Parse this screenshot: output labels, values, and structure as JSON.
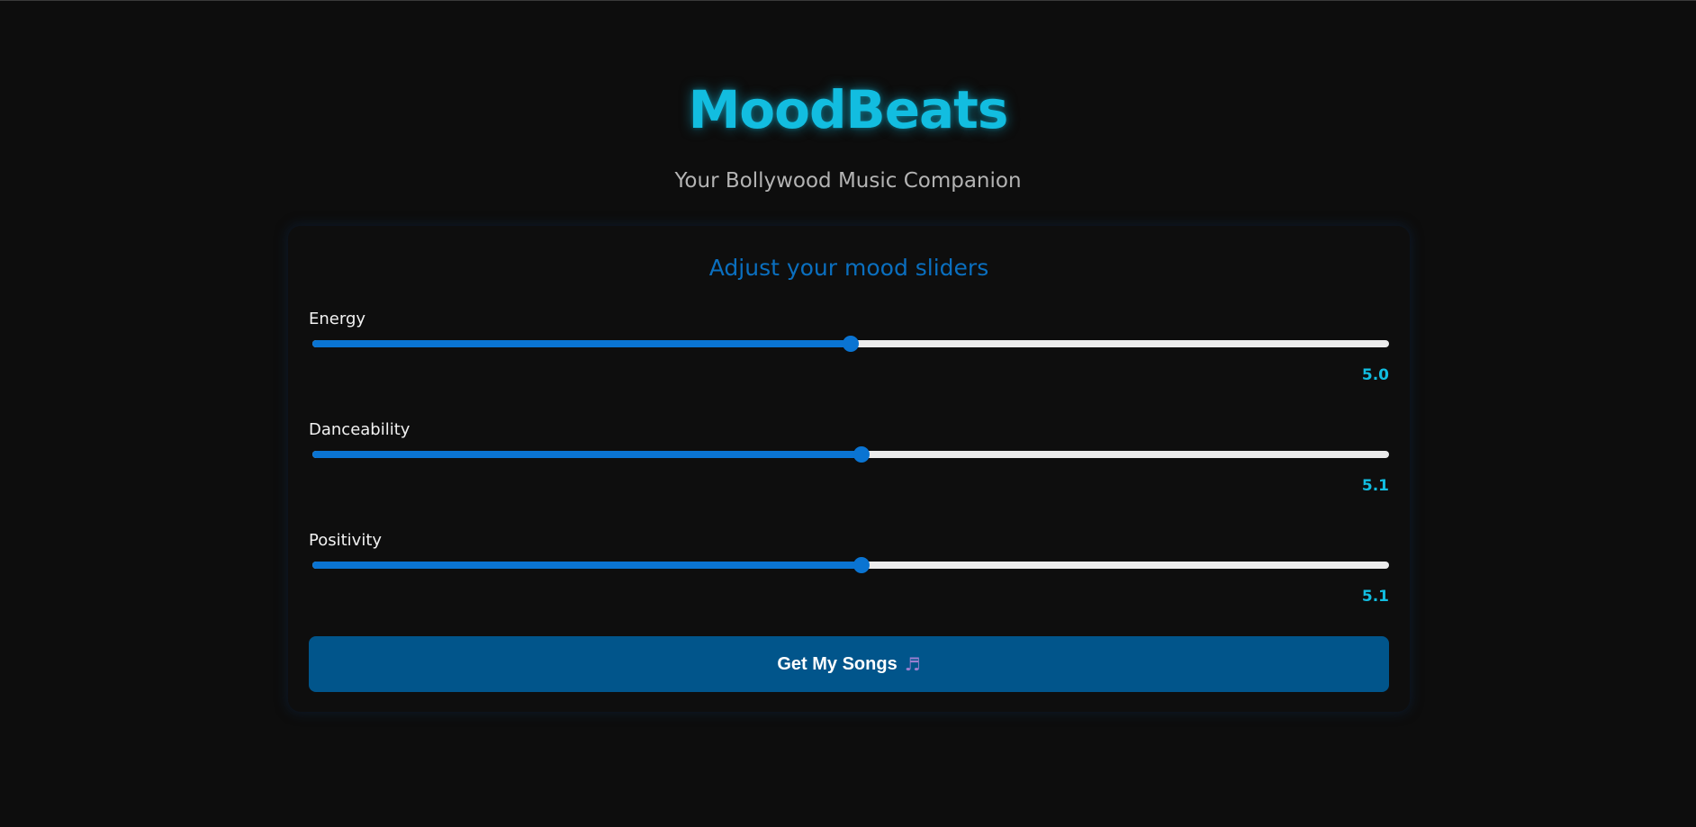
{
  "app": {
    "title": "MoodBeats",
    "subtitle": "Your Bollywood Music Companion"
  },
  "card": {
    "heading": "Adjust your mood sliders",
    "sliders": [
      {
        "label": "Energy",
        "value": 5.0,
        "value_text": "5.0",
        "min": 0,
        "max": 10
      },
      {
        "label": "Danceability",
        "value": 5.1,
        "value_text": "5.1",
        "min": 0,
        "max": 10
      },
      {
        "label": "Positivity",
        "value": 5.1,
        "value_text": "5.1",
        "min": 0,
        "max": 10
      }
    ],
    "button": {
      "label": "Get My Songs",
      "icon": "music-note-icon"
    }
  },
  "colors": {
    "background": "#0d0d0d",
    "title": "#12bde0",
    "heading": "#0a6fbf",
    "slider_fill": "#0a74d2",
    "slider_track": "#ececec",
    "button": "#01558b"
  }
}
